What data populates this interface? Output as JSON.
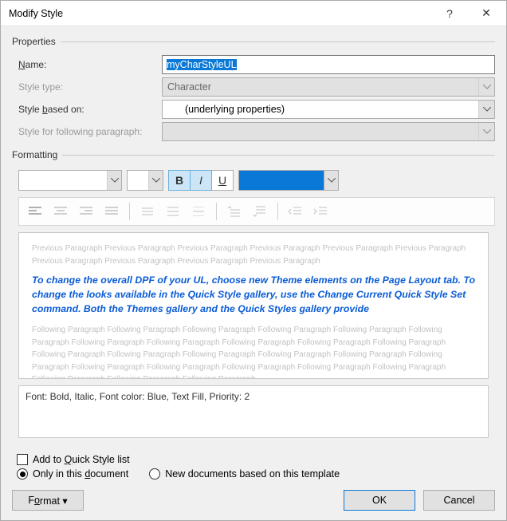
{
  "titlebar": {
    "title": "Modify Style",
    "help": "?",
    "close": "✕"
  },
  "groups": {
    "properties": "Properties",
    "formatting": "Formatting"
  },
  "labels": {
    "name": "Name:",
    "name_u": "N",
    "styletype": "Style type:",
    "basedon": "Style based on:",
    "basedon_u": "b",
    "following": "Style for following paragraph:"
  },
  "values": {
    "name": "myCharStyleUL",
    "styletype": "Character",
    "basedon": "(underlying properties)",
    "following": ""
  },
  "fmt": {
    "bold": "B",
    "italic": "I",
    "underline": "U",
    "color": "#0a78d6"
  },
  "preview": {
    "prev": "Previous Paragraph Previous Paragraph Previous Paragraph Previous Paragraph Previous Paragraph Previous Paragraph Previous Paragraph Previous Paragraph Previous Paragraph Previous Paragraph",
    "sample": "To change the overall DPF of your UL, choose new Theme elements on the Page Layout tab. To change the looks available in the Quick Style gallery, use the Change Current Quick Style Set command. Both the Themes gallery and the Quick Styles gallery provide",
    "next": "Following Paragraph Following Paragraph Following Paragraph Following Paragraph Following Paragraph Following Paragraph Following Paragraph Following Paragraph Following Paragraph Following Paragraph Following Paragraph Following Paragraph Following Paragraph Following Paragraph Following Paragraph Following Paragraph Following Paragraph Following Paragraph Following Paragraph Following Paragraph Following Paragraph Following Paragraph Following Paragraph Following Paragraph Following Paragraph"
  },
  "description": "Font: Bold, Italic, Font color: Blue, Text Fill, Priority: 2",
  "options": {
    "addquick": "Add to Quick Style list",
    "addquick_u": "Q",
    "onlydoc": "Only in this document",
    "onlydoc_u": "d",
    "newdocs": "New documents based on this template"
  },
  "buttons": {
    "format": "Format ▾",
    "format_u": "o",
    "ok": "OK",
    "cancel": "Cancel"
  }
}
